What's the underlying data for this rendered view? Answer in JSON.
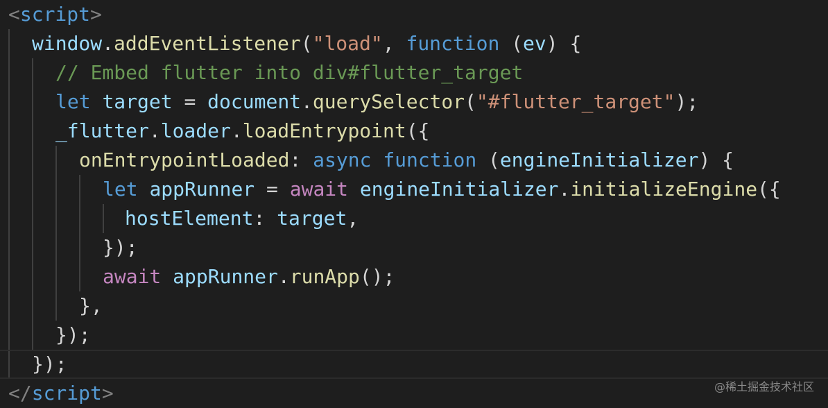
{
  "colors": {
    "background": "#1e1e1e",
    "tag_bracket": "#808080",
    "tag_name": "#569cd6",
    "variable": "#9cdcfe",
    "function": "#dcdcaa",
    "string": "#ce9178",
    "keyword": "#569cd6",
    "control_keyword": "#c586c0",
    "comment": "#6a9955",
    "punctuation": "#d4d4d4"
  },
  "code": {
    "l1": {
      "open": "<",
      "tag": "script",
      "close": ">"
    },
    "l2": {
      "a": "window",
      "b": ".",
      "c": "addEventListener",
      "d": "(",
      "e": "\"load\"",
      "f": ", ",
      "g": "function",
      "h": " (",
      "i": "ev",
      "j": ") {"
    },
    "l3": {
      "a": "// Embed flutter into div#flutter_target"
    },
    "l4": {
      "a": "let",
      "b": " ",
      "c": "target",
      "d": " = ",
      "e": "document",
      "f": ".",
      "g": "querySelector",
      "h": "(",
      "i": "\"#flutter_target\"",
      "j": ");"
    },
    "l5": {
      "a": "_flutter",
      "b": ".",
      "c": "loader",
      "d": ".",
      "e": "loadEntrypoint",
      "f": "({"
    },
    "l6": {
      "a": "onEntrypointLoaded",
      "b": ": ",
      "c": "async",
      "d": " ",
      "e": "function",
      "f": " (",
      "g": "engineInitializer",
      "h": ") {"
    },
    "l7": {
      "a": "let",
      "b": " ",
      "c": "appRunner",
      "d": " = ",
      "e": "await",
      "f": " ",
      "g": "engineInitializer",
      "h": ".",
      "i": "initializeEngine",
      "j": "({"
    },
    "l8": {
      "a": "hostElement",
      "b": ": ",
      "c": "target",
      "d": ","
    },
    "l9": {
      "a": "});"
    },
    "l10": {
      "a": "await",
      "b": " ",
      "c": "appRunner",
      "d": ".",
      "e": "runApp",
      "f": "();"
    },
    "l11": {
      "a": "},"
    },
    "l12": {
      "a": "});"
    },
    "l13": {
      "a": "});"
    },
    "l14": {
      "open": "</",
      "tag": "script",
      "close": ">"
    }
  },
  "watermark": "@稀土掘金技术社区"
}
